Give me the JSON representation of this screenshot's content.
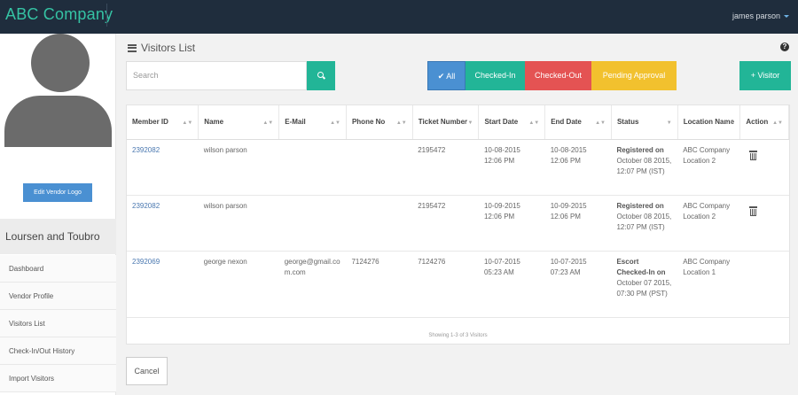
{
  "header": {
    "brand": "ABC Company",
    "user": "james parson"
  },
  "sidebar": {
    "edit_logo_label": "Edit Vendor Logo",
    "company_name": "Loursen and Toubro",
    "items": [
      {
        "label": "Dashboard"
      },
      {
        "label": "Vendor Profile"
      },
      {
        "label": "Visitors List"
      },
      {
        "label": "Check-In/Out History"
      },
      {
        "label": "Import Visitors"
      }
    ]
  },
  "main": {
    "title": "Visitors List",
    "search_placeholder": "Search",
    "filters": {
      "all": "✔ All",
      "checked_in": "Checked-In",
      "checked_out": "Checked-Out",
      "pending": "Pending Approval"
    },
    "visitor_button": "+ Visitor",
    "columns": [
      "Member ID",
      "Name",
      "E-Mail",
      "Phone No",
      "Ticket Number",
      "Start Date",
      "End Date",
      "Status",
      "Location Name",
      "Action"
    ],
    "rows": [
      {
        "member_id": "2392082",
        "name": "wilson parson",
        "email": "",
        "phone": "",
        "ticket": "2195472",
        "start": "10-08-2015 12:06 PM",
        "end": "10-08-2015 12:06 PM",
        "status_bold": "Registered on",
        "status_rest": "October 08 2015, 12:07 PM (IST)",
        "location": "ABC Company Location 2"
      },
      {
        "member_id": "2392082",
        "name": "wilson parson",
        "email": "",
        "phone": "",
        "ticket": "2195472",
        "start": "10-09-2015 12:06 PM",
        "end": "10-09-2015 12:06 PM",
        "status_bold": "Registered on",
        "status_rest": "October 08 2015, 12:07 PM (IST)",
        "location": "ABC Company Location 2"
      },
      {
        "member_id": "2392069",
        "name": "george nexon",
        "email": "george@gmail.com.com",
        "phone": "7124276",
        "ticket": "7124276",
        "start": "10-07-2015 05:23 AM",
        "end": "10-07-2015 07:23 AM",
        "status_bold": "Escort Checked-In on",
        "status_rest": "October 07 2015, 07:30 PM (PST)",
        "location": "ABC Company Location 1"
      }
    ],
    "footer": "Showing 1-3 of 3 Visitors",
    "cancel_label": "Cancel"
  }
}
